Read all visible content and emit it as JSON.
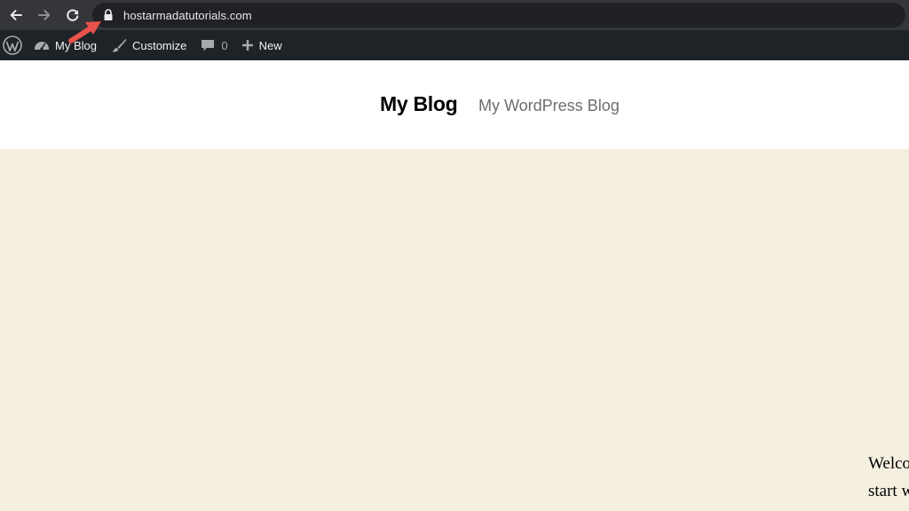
{
  "browser": {
    "url": "hostarmadatutorials.com",
    "icons": [
      "back-icon",
      "forward-icon",
      "reload-icon",
      "lock-icon"
    ]
  },
  "admin_bar": {
    "site_name": "My Blog",
    "customize": "Customize",
    "comments_count": "0",
    "new": "New"
  },
  "header": {
    "title": "My Blog",
    "tagline": "My WordPress Blog"
  },
  "content": {
    "line1": "Welco",
    "line2": "start w"
  },
  "colors": {
    "admin_bar": "#1d2327",
    "page_background": "#f5efe0",
    "annotation": "#e8524a"
  }
}
